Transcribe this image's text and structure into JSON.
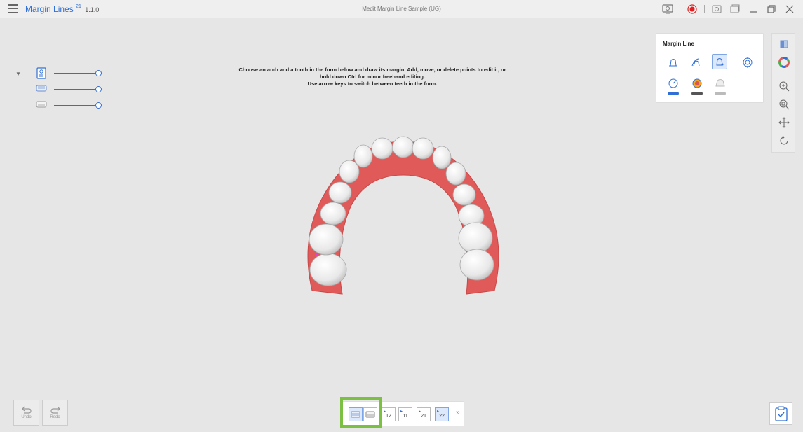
{
  "titlebar": {
    "app_name": "Margin Lines",
    "app_sup": "21",
    "app_version": "1.1.0",
    "document_title": "Medit Margin Line Sample (UG)",
    "recording_color": "#e02020"
  },
  "instruction": {
    "line1": "Choose an arch and a tooth in the form below and draw its margin. Add, move, or delete points to edit it, or",
    "line2": "hold down Ctrl for minor freehand editing.",
    "line3": "Use arrow keys to switch between teeth in the form."
  },
  "layers": [
    {
      "icon": "document-icon",
      "opacity": 1.0
    },
    {
      "icon": "upper-jaw-icon",
      "opacity": 1.0
    },
    {
      "icon": "lower-jaw-icon",
      "opacity": 1.0
    }
  ],
  "margin_panel": {
    "title": "Margin Line",
    "tools_row1": [
      "auto-margin-icon",
      "freehand-margin-icon",
      "edit-margin-icon",
      "target-icon"
    ],
    "tools_row2": [
      "gauge-toggle-icon",
      "color-map-toggle-icon",
      "die-toggle-icon"
    ],
    "toggle_states": [
      "on",
      "off",
      "disabled"
    ]
  },
  "side_toolbar": [
    "view-cube-icon",
    "color-wheel-icon",
    "zoom-in-icon",
    "zoom-fit-icon",
    "pan-icon",
    "rotate-icon"
  ],
  "undo_redo": {
    "undo_label": "Undo",
    "redo_label": "Redo"
  },
  "tooth_bar": {
    "arches": [
      "upper-arch-icon",
      "lower-arch-icon"
    ],
    "teeth": [
      {
        "num": "12",
        "selected": false
      },
      {
        "num": "11",
        "selected": false
      },
      {
        "num": "21",
        "selected": false
      },
      {
        "num": "22",
        "selected": true
      }
    ],
    "more": "»"
  },
  "colors": {
    "accent": "#2f6fd6",
    "gum": "#e05a5a",
    "highlight": "#7bc043"
  }
}
